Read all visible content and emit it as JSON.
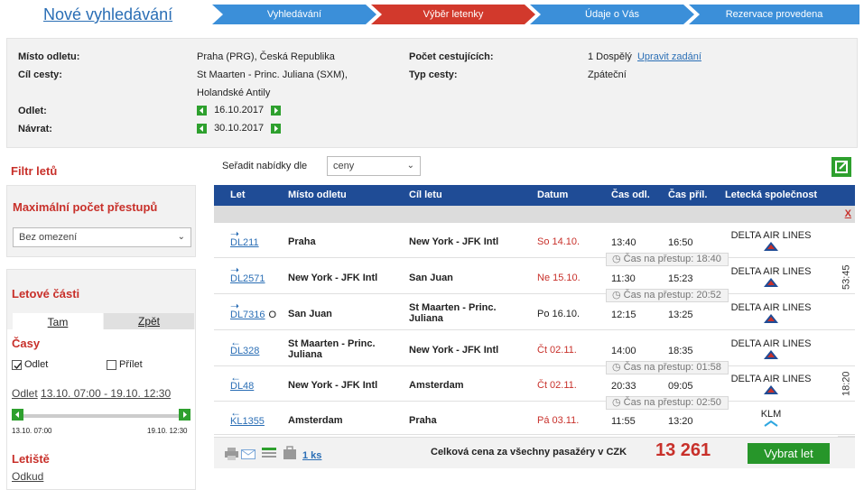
{
  "header": {
    "new_search": "Nové vyhledávání",
    "steps": [
      "Vyhledávání",
      "Výběr letenky",
      "Údaje o Vás",
      "Rezervace provedena"
    ],
    "colors": {
      "step_active": "#d2392c",
      "step": "#3b8fd9",
      "green": "#2ea02e",
      "navy": "#1f4c96"
    }
  },
  "summary": {
    "departure_label": "Místo odletu:",
    "departure_value": "Praha (PRG), Česká Republika",
    "destination_label": "Cíl cesty:",
    "destination_value_1": "St Maarten - Princ. Juliana (SXM),",
    "destination_value_2": "Holandské Antily",
    "outbound_label": "Odlet:",
    "outbound_value": "16.10.2017",
    "return_label": "Návrat:",
    "return_value": "30.10.2017",
    "passengers_label": "Počet cestujících:",
    "passengers_value": "1 Dospělý",
    "edit_link": "Upravit zadání",
    "trip_type_label": "Typ cesty:",
    "trip_type_value": "Zpáteční"
  },
  "filter": {
    "title": "Filtr letů",
    "max_transfers_title": "Maximální počet přestupů",
    "max_transfers_value": "Bez omezení",
    "segments_title": "Letové části",
    "tab_there": "Tam",
    "tab_back": "Zpět",
    "times_title": "Časy",
    "cb_departure": "Odlet",
    "cb_arrival": "Přílet",
    "range_label": "Odlet",
    "range_value": "13.10. 07:00 - 19.10. 12:30",
    "slider_min": "13.10. 07:00",
    "slider_max": "19.10. 12:30",
    "airports_title": "Letiště",
    "from_label": "Odkud"
  },
  "sort": {
    "label": "Seřadit nabídky dle",
    "value": "ceny"
  },
  "table": {
    "headers": [
      "Let",
      "Místo odletu",
      "Cíl letu",
      "Datum",
      "Čas odl.",
      "Čas příl.",
      "Letecká společnost"
    ],
    "close": "X",
    "outbound_duration": "53:45",
    "return_duration": "18:20",
    "rows": [
      {
        "flight": "DL211",
        "from": "Praha",
        "to": "New York - JFK Intl",
        "date": "So 14.10.",
        "dep": "13:40",
        "arr": "16:50",
        "airline": "DELTA AIR LINES",
        "extra": "",
        "transfer": "Čas na přestup: 18:40"
      },
      {
        "flight": "DL2571",
        "from": "New York - JFK Intl",
        "to": "San Juan",
        "date": "Ne 15.10.",
        "dep": "11:30",
        "arr": "15:23",
        "airline": "DELTA AIR LINES",
        "extra": "",
        "transfer": "Čas na přestup: 20:52"
      },
      {
        "flight": "DL7316",
        "from": "San Juan",
        "to": "St Maarten - Princ. Juliana",
        "date": "Po 16.10.",
        "dep": "12:15",
        "arr": "13:25",
        "airline": "DELTA AIR LINES",
        "extra": "O",
        "transfer": ""
      },
      {
        "flight": "DL328",
        "from": "St Maarten - Princ. Juliana",
        "to": "New York - JFK Intl",
        "date": "Čt 02.11.",
        "dep": "14:00",
        "arr": "18:35",
        "airline": "DELTA AIR LINES",
        "extra": "",
        "transfer": "Čas na přestup: 01:58"
      },
      {
        "flight": "DL48",
        "from": "New York - JFK Intl",
        "to": "Amsterdam",
        "date": "Čt 02.11.",
        "dep": "20:33",
        "arr": "09:05",
        "airline": "DELTA AIR LINES",
        "extra": "",
        "transfer": "Čas na přestup: 02:50"
      },
      {
        "flight": "KL1355",
        "from": "Amsterdam",
        "to": "Praha",
        "date": "Pá 03.11.",
        "dep": "11:55",
        "arr": "13:20",
        "airline": "KLM",
        "extra": "",
        "transfer": ""
      }
    ]
  },
  "footer": {
    "count_link": "1 ks",
    "total_label": "Celková cena za všechny pasažéry v CZK",
    "price": "13 261",
    "book_button": "Vybrat let"
  }
}
